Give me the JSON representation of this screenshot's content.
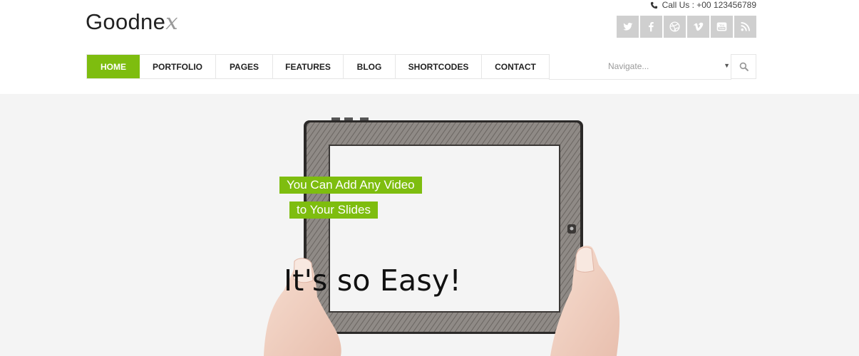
{
  "brand": {
    "name_main": "Goodne",
    "name_mark": "x"
  },
  "contact": {
    "label": "Call Us : +00 123456789"
  },
  "social": [
    {
      "icon": "twitter-icon"
    },
    {
      "icon": "facebook-icon"
    },
    {
      "icon": "dribbble-icon"
    },
    {
      "icon": "vimeo-icon"
    },
    {
      "icon": "youtube-icon"
    },
    {
      "icon": "rss-icon"
    }
  ],
  "nav": {
    "items": [
      {
        "label": "HOME",
        "active": true
      },
      {
        "label": "PORTFOLIO"
      },
      {
        "label": "PAGES"
      },
      {
        "label": "FEATURES"
      },
      {
        "label": "BLOG"
      },
      {
        "label": "SHORTCODES"
      },
      {
        "label": "CONTACT"
      }
    ],
    "select_placeholder": "Navigate...",
    "accent": "#7ebd0f"
  },
  "slider": {
    "caption_1": "You Can Add Any Video",
    "caption_2": "to Your Slides",
    "headline": "It's so Easy!"
  }
}
